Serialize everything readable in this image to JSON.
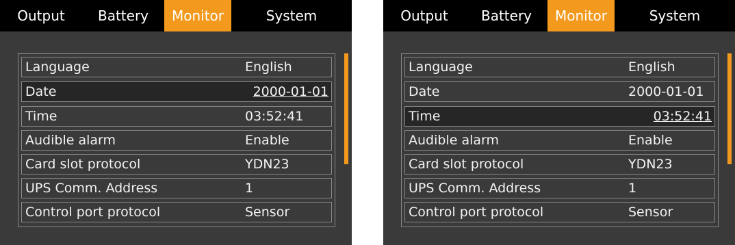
{
  "accent_color": "#f39a1e",
  "screens": [
    {
      "tabs": [
        {
          "label": "Output"
        },
        {
          "label": "Battery"
        },
        {
          "label": "Monitor"
        },
        {
          "label": "System"
        }
      ],
      "active_tab": "Monitor",
      "rows": [
        {
          "label": "Language",
          "value": "English"
        },
        {
          "label": "Date",
          "value": "2000-01-01"
        },
        {
          "label": "Time",
          "value": "03:52:41"
        },
        {
          "label": "Audible alarm",
          "value": "Enable"
        },
        {
          "label": "Card slot protocol",
          "value": "YDN23"
        },
        {
          "label": "UPS Comm. Address",
          "value": "1"
        },
        {
          "label": "Control port protocol",
          "value": "Sensor"
        }
      ],
      "selected_row": "Date"
    },
    {
      "tabs": [
        {
          "label": "Output"
        },
        {
          "label": "Battery"
        },
        {
          "label": "Monitor"
        },
        {
          "label": "System"
        }
      ],
      "active_tab": "Monitor",
      "rows": [
        {
          "label": "Language",
          "value": "English"
        },
        {
          "label": "Date",
          "value": "2000-01-01"
        },
        {
          "label": "Time",
          "value": "03:52:41"
        },
        {
          "label": "Audible alarm",
          "value": "Enable"
        },
        {
          "label": "Card slot protocol",
          "value": "YDN23"
        },
        {
          "label": "UPS Comm. Address",
          "value": "1"
        },
        {
          "label": "Control port protocol",
          "value": "Sensor"
        }
      ],
      "selected_row": "Time"
    }
  ]
}
